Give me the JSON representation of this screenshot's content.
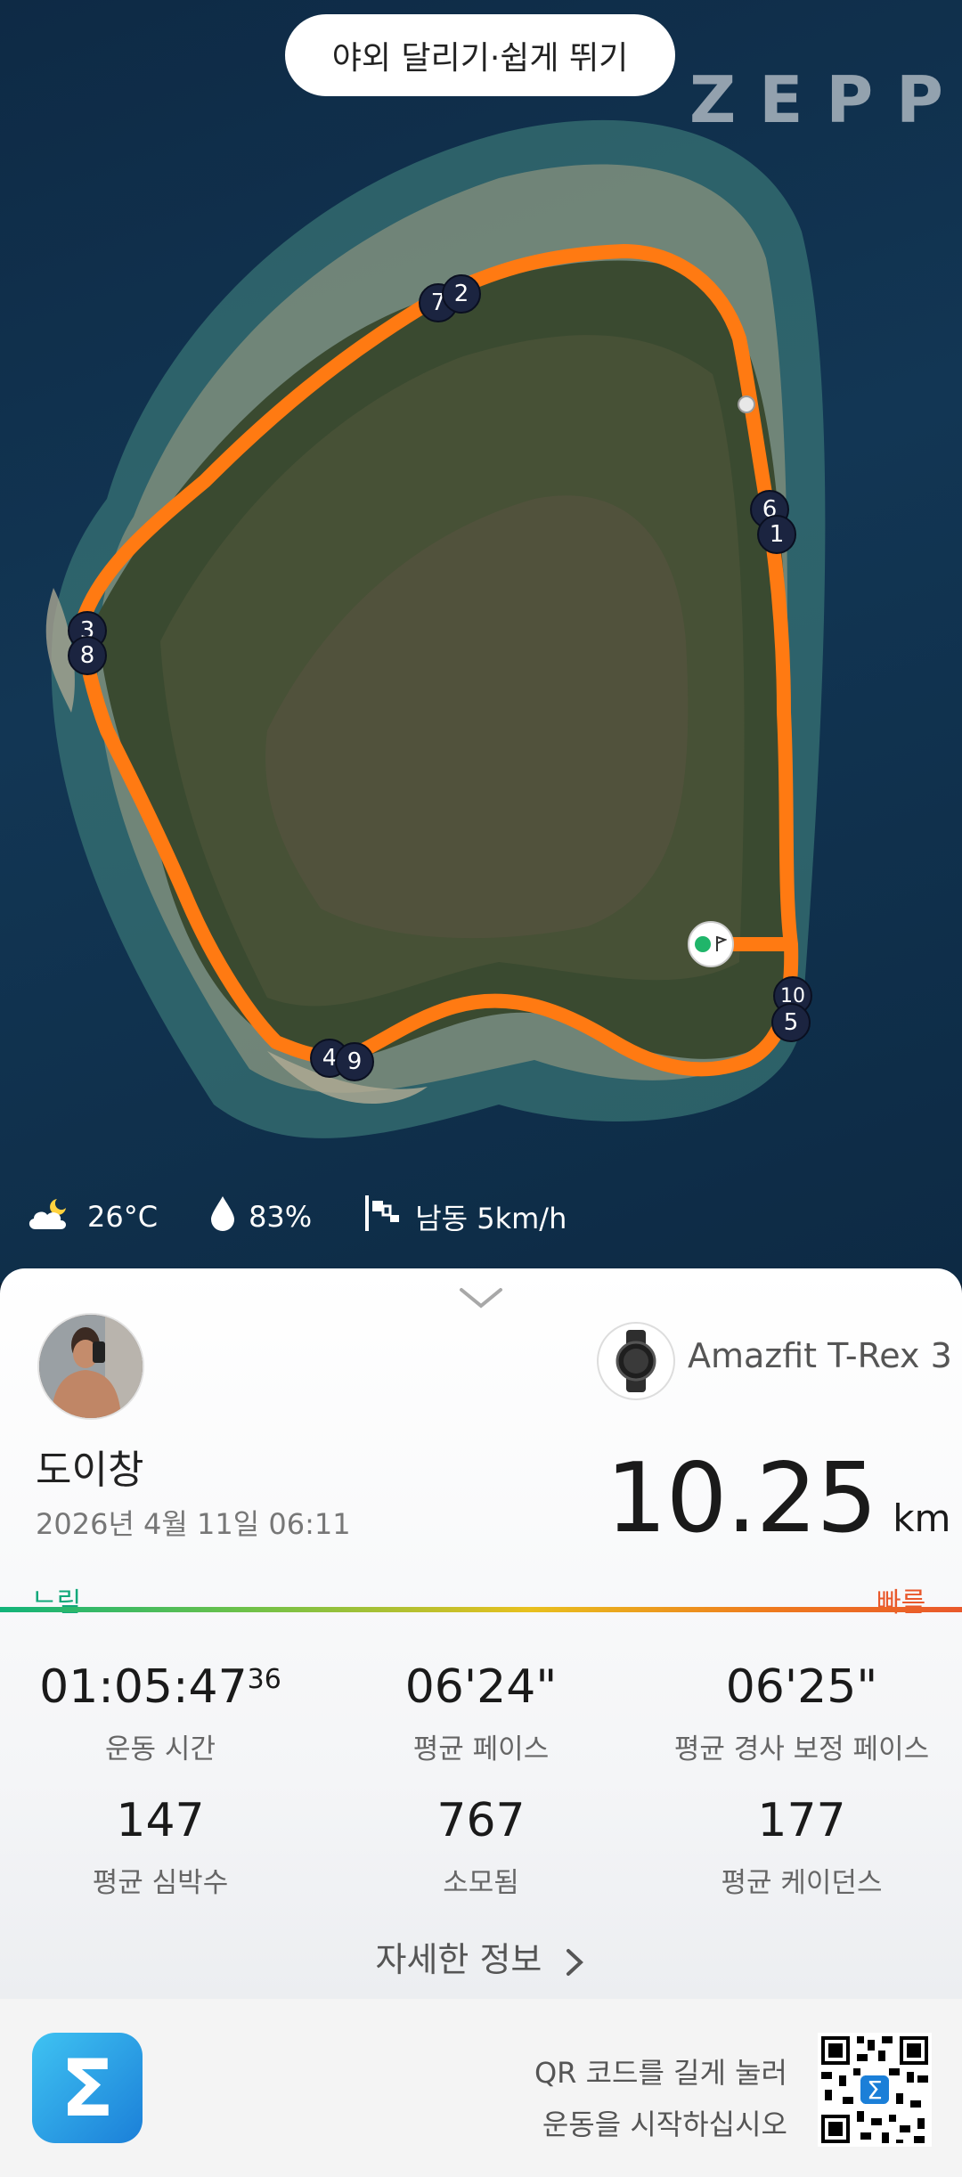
{
  "workout_title": "야외 달리기·쉽게 뛰기",
  "brand": "ZEPP",
  "route_markers": [
    "7",
    "2",
    "6",
    "1",
    "3",
    "8",
    "10",
    "5",
    "4",
    "9"
  ],
  "weather": {
    "temperature": "26°C",
    "humidity": "83%",
    "wind": "남동 5km/h"
  },
  "device": {
    "name": "Amazfit T-Rex 3"
  },
  "user": {
    "name": "도이창",
    "date": "2026년 4월 11일 06:11"
  },
  "distance": {
    "value": "10.25",
    "unit": "km"
  },
  "pace_scale": {
    "slow": "느림",
    "fast": "빠름"
  },
  "stats": [
    {
      "value": "01:05:47",
      "sub": "36",
      "label": "운동 시간"
    },
    {
      "value": "06'24\"",
      "label": "평균 페이스"
    },
    {
      "value": "06'25\"",
      "label": "평균 경사 보정 페이스"
    },
    {
      "value": "147",
      "label": "평균 심박수"
    },
    {
      "value": "767",
      "label": "소모됨"
    },
    {
      "value": "177",
      "label": "평균 케이던스"
    }
  ],
  "more_info": "자세한 정보",
  "footer": {
    "qr_line1": "QR 코드를 길게 눌러",
    "qr_line2": "운동을 시작하십시오"
  },
  "colors": {
    "route": "#ff7a12",
    "slow": "#12a87a",
    "fast": "#e9582b"
  }
}
